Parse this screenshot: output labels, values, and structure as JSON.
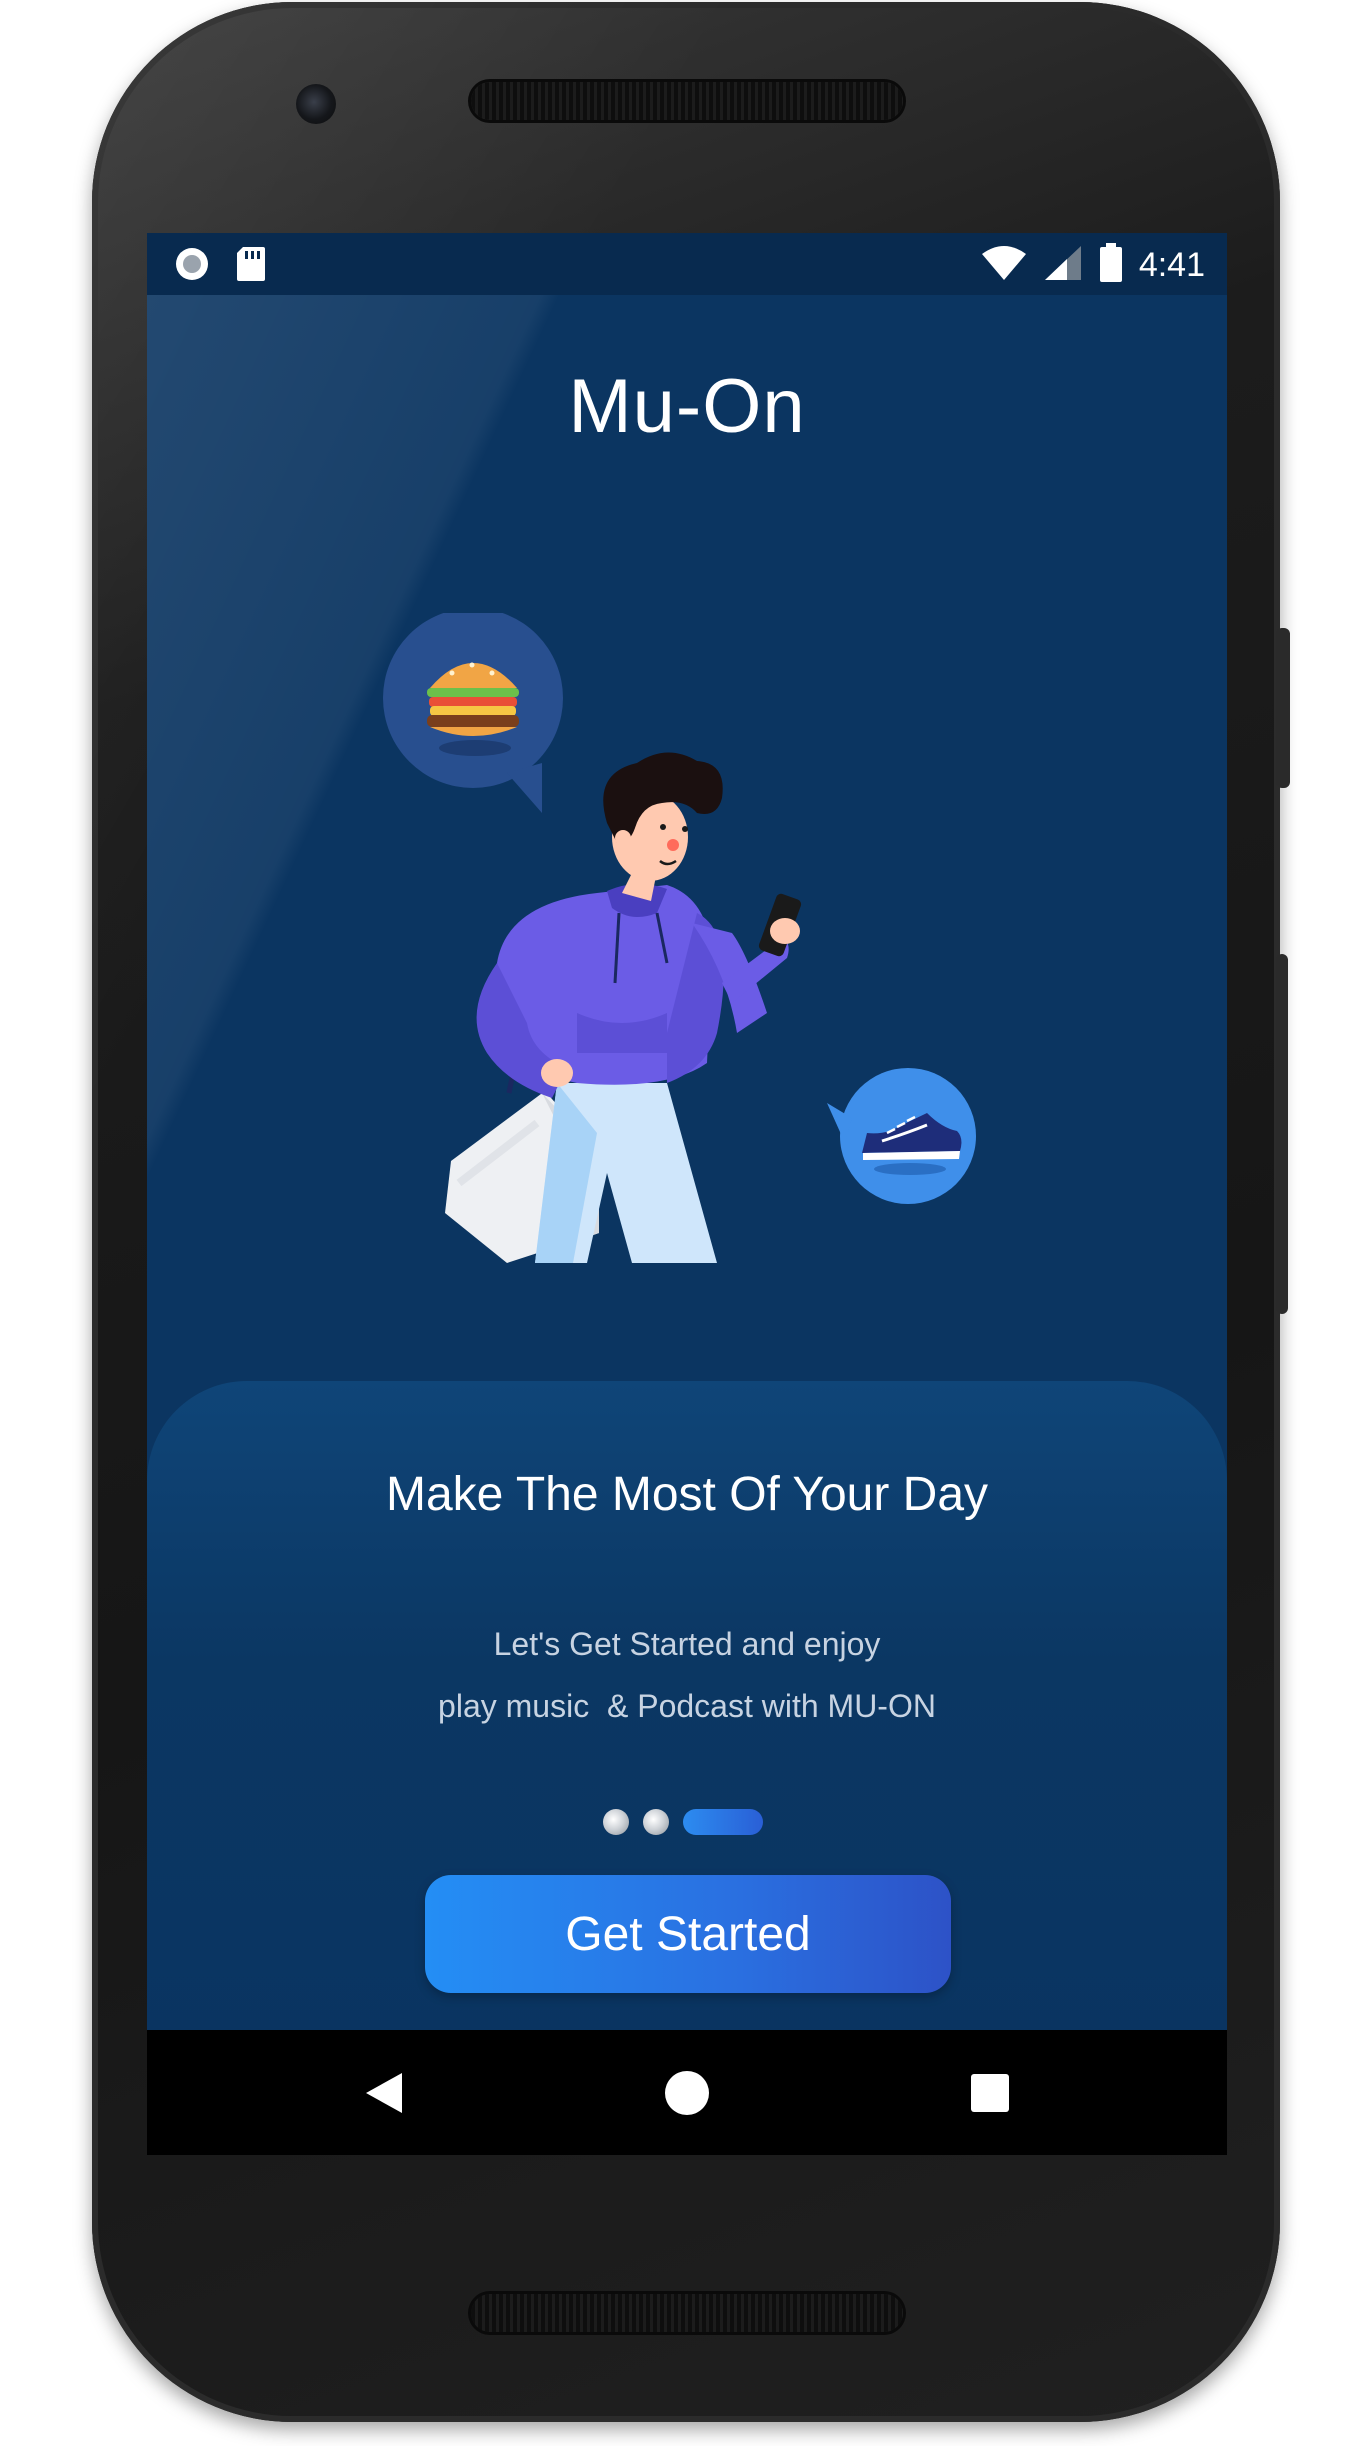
{
  "status_bar": {
    "time": "4:41",
    "left_icons": [
      "record-icon",
      "sd-card-icon"
    ],
    "right_icons": [
      "wifi-icon",
      "signal-icon",
      "battery-icon"
    ]
  },
  "app": {
    "title": "Mu-On"
  },
  "onboarding": {
    "heading": "Make The Most Of Your Day",
    "body_line_1": "Let's Get Started and enjoy",
    "body_line_2": "play music  & Podcast with MU-ON",
    "page_indicator": {
      "total": 3,
      "active_index": 2
    },
    "cta_label": "Get Started"
  },
  "illustration": {
    "subject": "person-walking-with-phone-and-shopping-bag",
    "bubbles": [
      "burger-icon",
      "sneaker-icon"
    ]
  },
  "nav_bar": {
    "buttons": [
      "back-icon",
      "home-icon",
      "recents-icon"
    ]
  },
  "colors": {
    "background": "#0b3561",
    "card": "#0f4578",
    "accent": "#248ef5",
    "hoodie": "#6b5ce6"
  }
}
